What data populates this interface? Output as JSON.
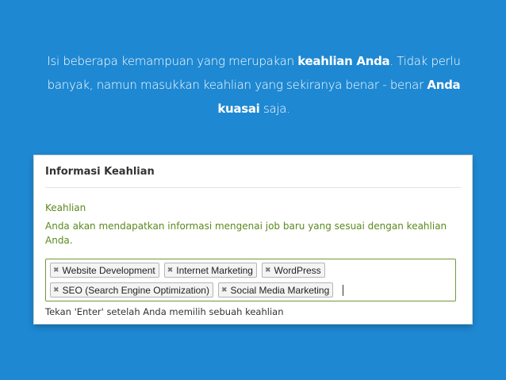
{
  "intro": {
    "part1": "Isi beberapa kemampuan yang merupakan ",
    "bold1": "keahlian Anda",
    "part2": ". Tidak perlu banyak, namun masukkan keahlian yang sekiranya benar - benar ",
    "bold2": "Anda kuasai",
    "part3": " saja."
  },
  "panel": {
    "title": "Informasi Keahlian",
    "field_label": "Keahlian",
    "field_description": "Anda akan mendapatkan informasi mengenai job baru yang sesuai dengan keahlian Anda.",
    "tags_row1": [
      "Website Development",
      "Internet Marketing",
      "WordPress"
    ],
    "tags_row2": [
      "SEO (Search Engine Optimization)",
      "Social Media Marketing"
    ],
    "remove_glyph": "✖",
    "hint": "Tekan 'Enter' setelah Anda memilih sebuah keahlian"
  },
  "colors": {
    "background": "#1e88d2",
    "label_green": "#5a8a1e",
    "input_border": "#6f9a3a"
  }
}
